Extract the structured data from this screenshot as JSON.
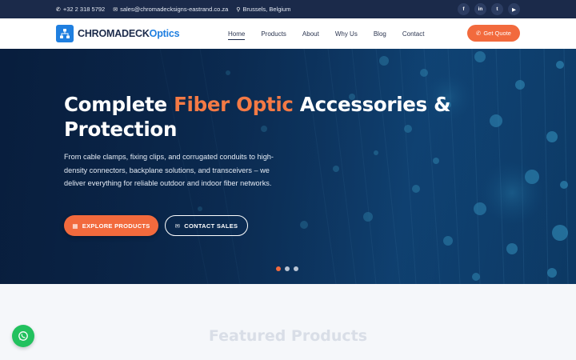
{
  "topbar": {
    "phone": "+32 2 318 5792",
    "email": "sales@chromadecksigns-eastrand.co.za",
    "location": "Brussels, Belgium",
    "social": [
      {
        "icon": "facebook-icon",
        "glyph": "f"
      },
      {
        "icon": "linkedin-icon",
        "glyph": "in"
      },
      {
        "icon": "twitter-icon",
        "glyph": "t"
      },
      {
        "icon": "youtube-icon",
        "glyph": "▶"
      }
    ]
  },
  "header": {
    "logo_main": "CHROMADECK",
    "logo_accent": "Optics",
    "nav": [
      "Home",
      "Products",
      "About",
      "Why Us",
      "Blog",
      "Contact"
    ],
    "active_nav": "Home",
    "quote_label": "Get Quote"
  },
  "hero": {
    "title_part1": "Complete ",
    "title_highlight": "Fiber Optic",
    "title_part2": " Accessories & Protection",
    "description": "From cable clamps, fixing clips, and corrugated conduits to high-density connectors, backplane solutions, and transceivers – we deliver everything for reliable outdoor and indoor fiber networks.",
    "explore_label": "EXPLORE PRODUCTS",
    "contact_label": "CONTACT SALES",
    "slide_count": 3,
    "active_slide": 1
  },
  "featured": {
    "title": "Featured Products"
  },
  "colors": {
    "brand_blue": "#1f7fe0",
    "accent_orange": "#f26a3d",
    "navy": "#1b2a4a",
    "whatsapp_green": "#22c15e"
  }
}
